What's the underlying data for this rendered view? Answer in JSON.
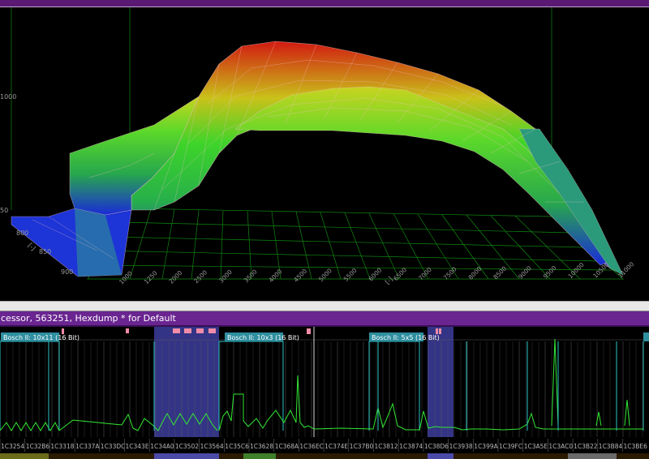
{
  "window": {
    "hexdump_title": "cessor, 563251, Hexdump * for Default"
  },
  "map_3d": {
    "x_axis_ticks": [
      "1000",
      "1250",
      "2000",
      "2500",
      "3000",
      "3500",
      "4000",
      "4500",
      "5000",
      "5500",
      "6000",
      "6500",
      "7000",
      "7500",
      "8000",
      "8500",
      "9000",
      "9500",
      "10000",
      "10500",
      "11000"
    ],
    "x_axis_unit": "[-]",
    "y_axis_ticks": [
      "800",
      "850",
      "900"
    ],
    "y_axis_unit": "[-]",
    "z_axis_ticks": [
      "50",
      "1000"
    ],
    "colors": {
      "low": "#1a2bd8",
      "mid": "#2fd72a",
      "high": "#d21a12",
      "grid": "#14a014",
      "mesh": "#f0c3c3"
    }
  },
  "hexdump": {
    "map_labels": [
      {
        "label": "Bosch II: 10x11 (16 Bit)"
      },
      {
        "label": "Bosch II: 10x3 (16 Bit)"
      },
      {
        "label": "Bosch II: 5x5 (16 Bit)"
      }
    ],
    "addresses": [
      "1C3254",
      "1C32B6",
      "1C3318",
      "1C337A",
      "1C33DC",
      "1C343E",
      "1C34A0",
      "1C3502",
      "1C3564",
      "1C35C6",
      "1C3628",
      "1C368A",
      "1C36EC",
      "1C374E",
      "1C37B0",
      "1C3812",
      "1C3874",
      "1C38D6",
      "1C3938",
      "1C399A",
      "1C39FC",
      "1C3A5E",
      "1C3AC0",
      "1C3B22",
      "1C3B84",
      "1C3BE6"
    ],
    "colors": {
      "background": "#000000",
      "grid": "#5a5a5a",
      "map_outline": "#2ec4c4",
      "selection": "#3d3d9e",
      "trace": "#32e832",
      "marker": "#f08ca8"
    }
  }
}
